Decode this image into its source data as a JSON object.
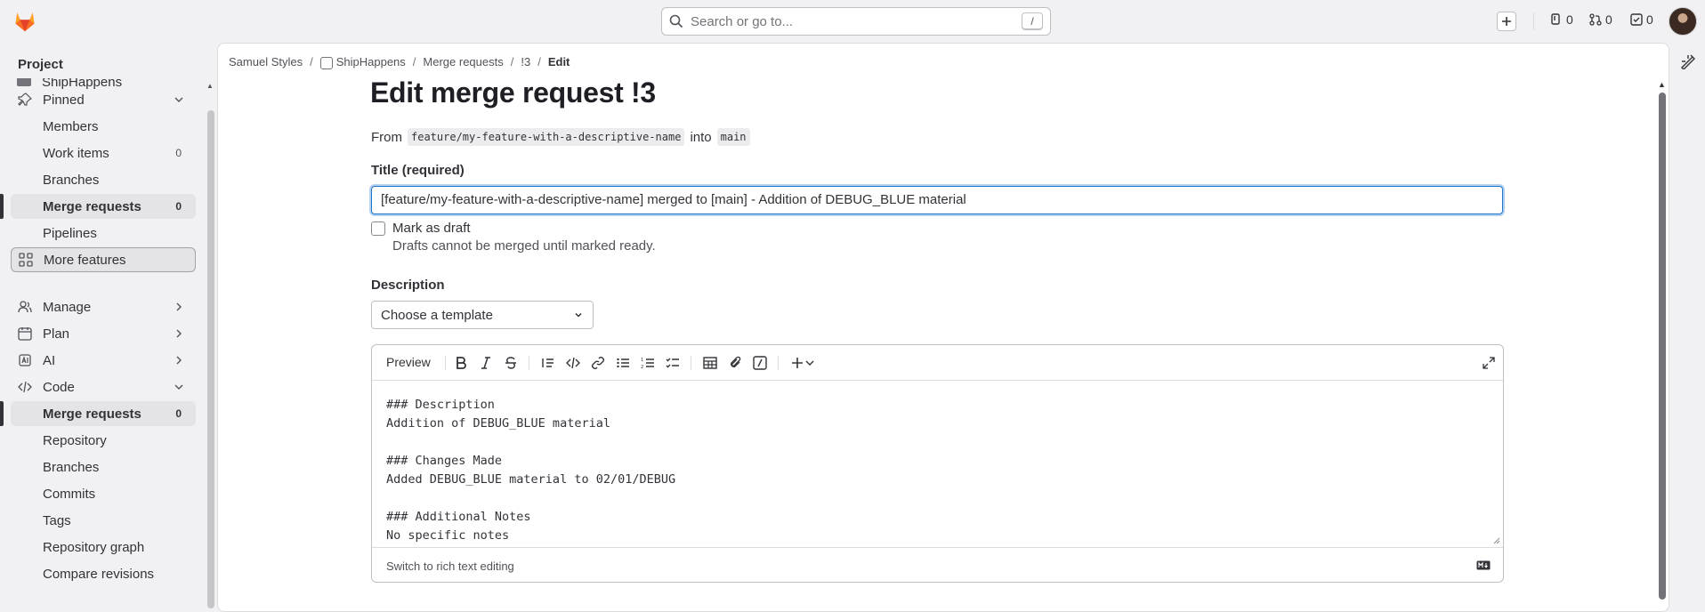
{
  "search": {
    "placeholder": "Search or go to...",
    "shortcut": "/"
  },
  "topbar": {
    "counters": [
      {
        "name": "issues",
        "value": "0"
      },
      {
        "name": "merge-requests",
        "value": "0"
      },
      {
        "name": "todos",
        "value": "0"
      }
    ]
  },
  "sidebar": {
    "header": "Project",
    "cut_item": "ShipHappens",
    "items": [
      {
        "label": "Pinned",
        "icon": "pin-icon",
        "chevron": "down"
      },
      {
        "label": "Members"
      },
      {
        "label": "Work items",
        "count": "0"
      },
      {
        "label": "Branches"
      },
      {
        "label": "Merge requests",
        "count": "0",
        "active": true
      },
      {
        "label": "Pipelines"
      },
      {
        "label": "More features",
        "icon": "grid-icon"
      },
      {
        "label": "Manage",
        "icon": "users-icon",
        "chevron": "right"
      },
      {
        "label": "Plan",
        "icon": "calendar-icon",
        "chevron": "right"
      },
      {
        "label": "AI",
        "icon": "ai-icon",
        "chevron": "right"
      },
      {
        "label": "Code",
        "icon": "code-icon",
        "chevron": "down"
      },
      {
        "label": "Merge requests",
        "count": "0",
        "active": true
      },
      {
        "label": "Repository"
      },
      {
        "label": "Branches"
      },
      {
        "label": "Commits"
      },
      {
        "label": "Tags"
      },
      {
        "label": "Repository graph"
      },
      {
        "label": "Compare revisions"
      }
    ]
  },
  "breadcrumbs": [
    "Samuel Styles",
    "ShipHappens",
    "Merge requests",
    "!3",
    "Edit"
  ],
  "page": {
    "title": "Edit merge request !3",
    "from_label": "From",
    "source_branch": "feature/my-feature-with-a-descriptive-name",
    "into_label": "into",
    "target_branch": "main"
  },
  "form": {
    "title_label": "Title (required)",
    "title_value": "[feature/my-feature-with-a-descriptive-name] merged to [main] - Addition of DEBUG_BLUE material",
    "draft_label": "Mark as draft",
    "draft_help": "Drafts cannot be merged until marked ready.",
    "description_label": "Description",
    "template_select": "Choose a template",
    "preview_label": "Preview",
    "description_text": "### Description\nAddition of DEBUG_BLUE material\n\n### Changes Made\nAdded DEBUG_BLUE material to 02/01/DEBUG\n\n### Additional Notes\nNo specific notes",
    "switch_label": "Switch to rich text editing"
  },
  "colors": {
    "accent": "#1f75cb",
    "brand": "#fc6d26"
  }
}
